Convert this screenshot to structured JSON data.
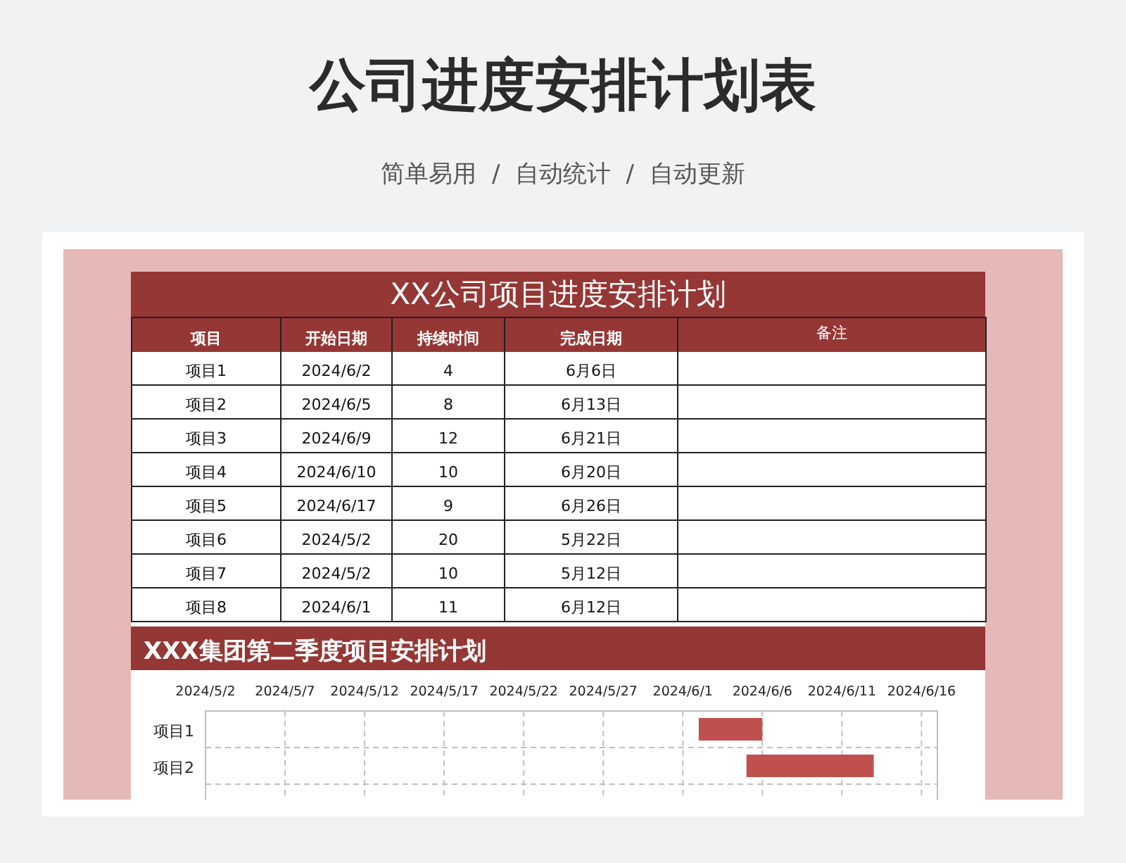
{
  "page_title": "公司进度安排计划表",
  "subtitle": "简单易用  /  自动统计  /  自动更新",
  "sheet": {
    "title": "XX公司项目进度安排计划",
    "columns": [
      "项目",
      "开始日期",
      "持续时间",
      "完成日期",
      "备注"
    ],
    "rows": [
      [
        "项目1",
        "2024/6/2",
        "4",
        "6月6日"
      ],
      [
        "项目2",
        "2024/6/5",
        "8",
        "6月13日"
      ],
      [
        "项目3",
        "2024/6/9",
        "12",
        "6月21日"
      ],
      [
        "项目4",
        "2024/6/10",
        "10",
        "6月20日"
      ],
      [
        "项目5",
        "2024/6/17",
        "9",
        "6月26日"
      ],
      [
        "项目6",
        "2024/5/2",
        "20",
        "5月22日"
      ],
      [
        "项目7",
        "2024/5/2",
        "10",
        "5月12日"
      ],
      [
        "项目8",
        "2024/6/1",
        "11",
        "6月12日"
      ]
    ]
  },
  "gantt": {
    "title": "XXX集团第二季度项目安排计划",
    "date_labels": [
      "2024/5/2",
      "2024/5/7",
      "2024/5/12",
      "2024/5/17",
      "2024/5/22",
      "2024/5/27",
      "2024/6/1",
      "2024/6/6",
      "2024/6/11",
      "2024/6/16"
    ],
    "row_labels": [
      "项目1",
      "项目2"
    ]
  }
}
